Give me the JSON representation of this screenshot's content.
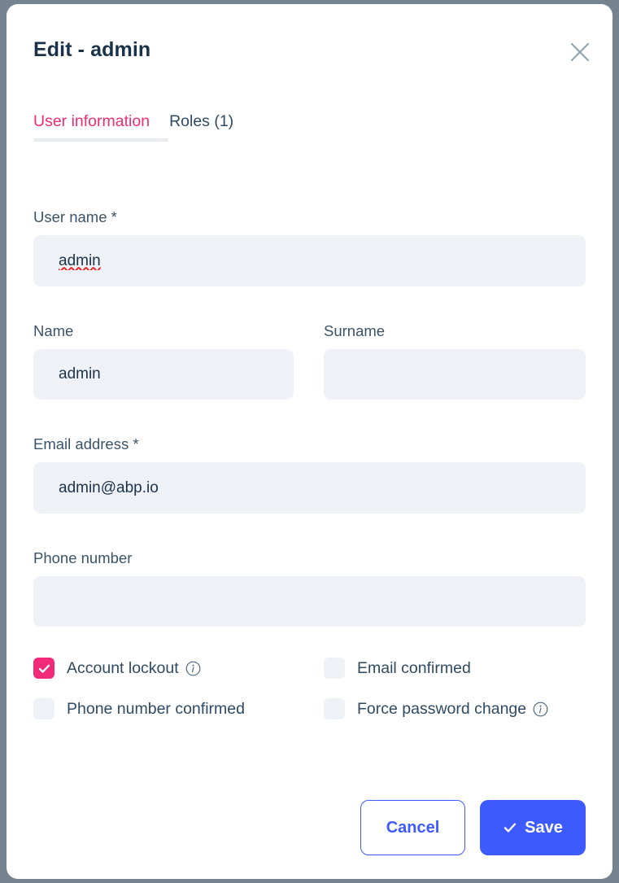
{
  "theme": {
    "backdrop": "#74838f",
    "modal_bg": "#ffffff",
    "accent_pink": "#f02a78",
    "accent_blue": "#3d5afe",
    "label_color": "#3a5369",
    "input_bg": "#eef2f6",
    "title_color": "#19324a"
  },
  "header": {
    "title": "Edit - admin",
    "close_icon": "close-icon"
  },
  "tabs": [
    {
      "label": "User information",
      "active": true
    },
    {
      "label": "Roles (1)",
      "active": false
    }
  ],
  "form": {
    "username": {
      "label": "User name *",
      "value": "admin",
      "placeholder": "",
      "spellcheck_flag": true
    },
    "name": {
      "label": "Name",
      "value": "admin",
      "placeholder": ""
    },
    "surname": {
      "label": "Surname",
      "value": "",
      "placeholder": ""
    },
    "email": {
      "label": "Email address *",
      "value": "admin@abp.io",
      "placeholder": ""
    },
    "phone": {
      "label": "Phone number",
      "value": "",
      "placeholder": ""
    }
  },
  "checkboxes": [
    {
      "label": "Account lockout",
      "checked": true,
      "has_info": true,
      "info_icon": "info-circle-icon"
    },
    {
      "label": "Email confirmed",
      "checked": false,
      "has_info": false,
      "info_icon": ""
    },
    {
      "label": "Phone number confirmed",
      "checked": false,
      "has_info": false,
      "info_icon": ""
    },
    {
      "label": "Force password change",
      "checked": true,
      "has_info": true,
      "info_icon": "info-circle-icon"
    }
  ],
  "footer": {
    "cancel_label": "Cancel",
    "save_label": "Save",
    "save_icon": "check-icon"
  }
}
